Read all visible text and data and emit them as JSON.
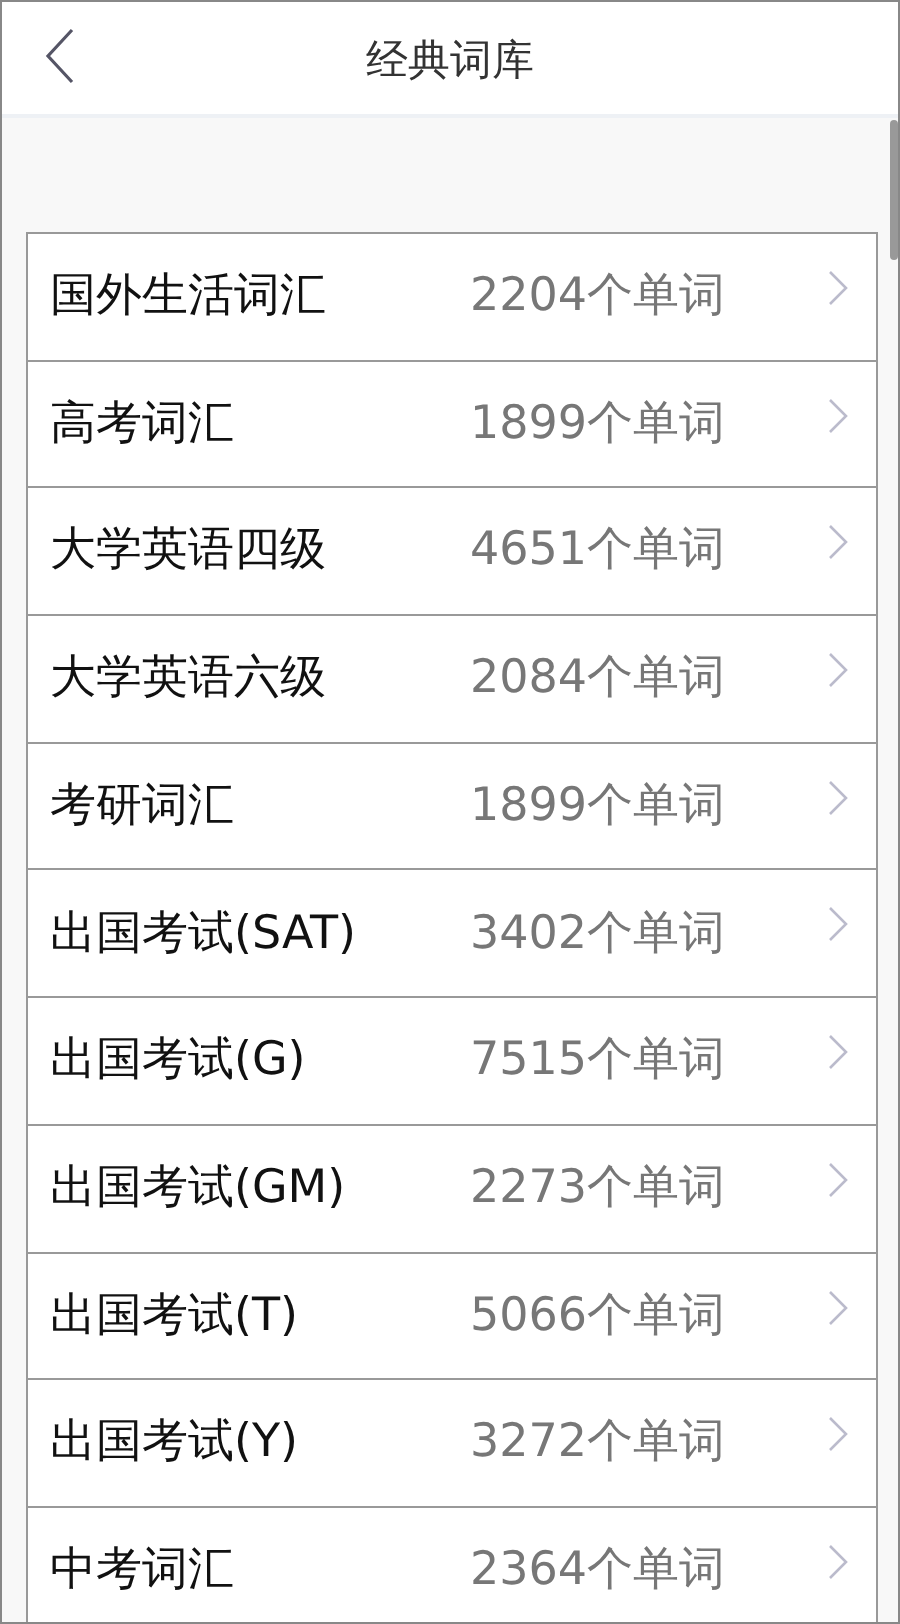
{
  "header": {
    "title": "经典词库"
  },
  "wordbooks": [
    {
      "name": "国外生活词汇",
      "count": "2204个单词"
    },
    {
      "name": "高考词汇",
      "count": "1899个单词"
    },
    {
      "name": "大学英语四级",
      "count": "4651个单词"
    },
    {
      "name": "大学英语六级",
      "count": "2084个单词"
    },
    {
      "name": "考研词汇",
      "count": "1899个单词"
    },
    {
      "name": "出国考试(SAT)",
      "count": "3402个单词"
    },
    {
      "name": "出国考试(G)",
      "count": "7515个单词"
    },
    {
      "name": "出国考试(GM)",
      "count": "2273个单词"
    },
    {
      "name": "出国考试(T)",
      "count": "5066个单词"
    },
    {
      "name": "出国考试(Y)",
      "count": "3272个单词"
    },
    {
      "name": "中考词汇",
      "count": "2364个单词"
    }
  ]
}
